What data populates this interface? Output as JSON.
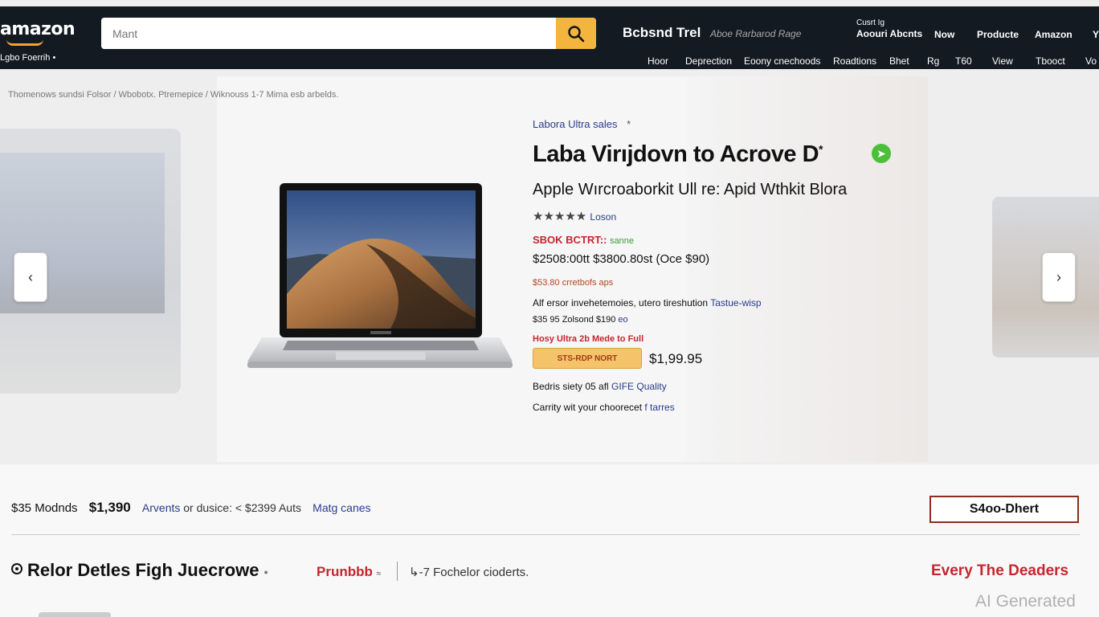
{
  "header": {
    "logo": "amazon",
    "deliver_to": "Lgbo Foerrih",
    "search_placeholder": "Mant",
    "brand_title": "Bcbsnd Trel",
    "brand_subtitle": "Aboe Rarbarod Rage",
    "account_line1": "Cusrt Ig",
    "account_line2": "Aoouri Abcnts",
    "top_nav": [
      "Now",
      "Producte",
      "Amazon",
      "Y"
    ],
    "sub_nav": [
      "Hoor",
      "Deprection",
      "Eoony cnechoods",
      "Roadtions",
      "Bhet",
      "Rg",
      "T60",
      "View",
      "Tbooct",
      "Vo"
    ]
  },
  "breadcrumb": "Thomenows sundsi Folsor / Wbobotx. Ptremepice / Wiknouss 1-7 Mima esb arbelds.",
  "product": {
    "store_link": "Labora Ultra sales",
    "store_link_suffix": "*",
    "title": "Laba Virıjdovn to Acrove D",
    "title_superscript": "*",
    "subtitle": "Apple Wırcroaborkit Ull re: Apid Wthkit Blora",
    "stars": "★★★★★",
    "rating_link": "Loson",
    "deal_label": "SBOK BCTRT::",
    "deal_note": "sanne",
    "prices": "$2508:00tt   $3800.80st (Oce $90)",
    "savings": "$53.80 crretbofs aps",
    "desc_text": "Alf ersor invehetemoies, utero tireshution ",
    "desc_link": "Tastue-wisp",
    "coupon_text": "$35 95 Zolsond $190 ",
    "coupon_link": "eo",
    "promo": "Hosy Ultra 2b Mede to Full",
    "buy_button": "STS-RDP NORT",
    "buy_price": "$1,99.95",
    "bundle_text": "Bedris siety 05 afl ",
    "bundle_link": "GIFE Quality",
    "carry_text": "Carrity wit your choorecet ",
    "carry_link": "f tarres"
  },
  "summary": {
    "items": "$35 Modnds",
    "price": "$1,390",
    "link1": "Arvents",
    "middle": " or dusice: < $2399 Auts",
    "link2": "Matg canes",
    "button": "S4oo-Dhert"
  },
  "section": {
    "title": "Relor Detles Figh Juecrowe",
    "title_suffix": "•",
    "tab_red": "Prunbbb",
    "tab_red_suffix": "≈",
    "tab_gray": "-7 Fochelor cioderts.",
    "every_link": "Every The Deaders"
  },
  "watermark": "AI Generated",
  "colors": {
    "header_bg": "#131a22",
    "search_button": "#f3b53d",
    "deal_red": "#c7252f",
    "link_blue": "#2a3c8a",
    "verify_green": "#4cbf3a"
  }
}
